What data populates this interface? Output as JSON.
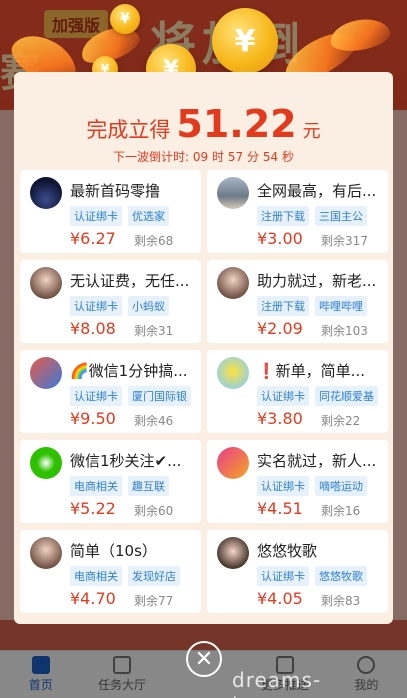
{
  "background": {
    "badge": "加强版",
    "big_text": "将加倒",
    "left_text": "赛"
  },
  "tabbar": [
    {
      "label": "首页",
      "icon": "home-icon",
      "active": true
    },
    {
      "label": "任务大厅",
      "icon": "list-icon",
      "active": false
    },
    {
      "label": "",
      "icon": "center-icon",
      "active": false
    },
    {
      "label": "更多推送",
      "icon": "grid-icon",
      "active": false
    },
    {
      "label": "我的",
      "icon": "user-icon",
      "active": false
    }
  ],
  "coin_symbol": "¥",
  "modal": {
    "hero_prefix": "完成立得",
    "hero_amount": "51.22",
    "hero_unit": "元",
    "countdown_label": "下一波倒计时:",
    "countdown_h": "09",
    "countdown_h_unit": "时",
    "countdown_m": "57",
    "countdown_m_unit": "分",
    "countdown_s": "54",
    "countdown_s_unit": "秒",
    "cards": [
      {
        "title": "最新首码零撸",
        "tags": [
          "认证绑卡",
          "优选家"
        ],
        "price": "¥6.27",
        "remain": "剩余68",
        "avatar": "night-city-icon"
      },
      {
        "title": "全网最高，有后...",
        "tags": [
          "注册下载",
          "三国主公"
        ],
        "price": "¥3.00",
        "remain": "剩余317",
        "avatar": "landscape-icon"
      },
      {
        "title": "无认证费，无任...",
        "tags": [
          "认证绑卡",
          "小蚂蚁"
        ],
        "price": "¥8.08",
        "remain": "剩余31",
        "avatar": "girl-photo-icon"
      },
      {
        "title": "助力就过，新老...",
        "tags": [
          "注册下载",
          "哔哩哔哩"
        ],
        "price": "¥2.09",
        "remain": "剩余103",
        "avatar": "girl-photo-icon"
      },
      {
        "title": "🌈微信1分钟搞...",
        "tags": [
          "认证绑卡",
          "厦门国际银"
        ],
        "price": "¥9.50",
        "remain": "剩余46",
        "avatar": "wallet-icon"
      },
      {
        "title": "❗新单，简单...",
        "tags": [
          "认证绑卡",
          "同花顺爱基"
        ],
        "price": "¥3.80",
        "remain": "剩余22",
        "avatar": "sponge-icon"
      },
      {
        "title": "微信1秒关注✔...",
        "tags": [
          "电商相关",
          "趣互联"
        ],
        "price": "¥5.22",
        "remain": "剩余60",
        "avatar": "wechat-icon"
      },
      {
        "title": "实名就过，新人...",
        "tags": [
          "认证绑卡",
          "嘀嗒运动"
        ],
        "price": "¥4.51",
        "remain": "剩余16",
        "avatar": "poster-icon"
      },
      {
        "title": "简单（10s）",
        "tags": [
          "电商相关",
          "发现好店"
        ],
        "price": "¥4.70",
        "remain": "剩余77",
        "avatar": "girl-photo-icon"
      },
      {
        "title": "悠悠牧歌",
        "tags": [
          "认证绑卡",
          "悠悠牧歌"
        ],
        "price": "¥4.05",
        "remain": "剩余83",
        "avatar": "boy-photo-icon"
      }
    ]
  },
  "close_symbol": "✕",
  "watermark": "dreams-true.com",
  "colors": {
    "accent": "#e23a1d",
    "tag_text": "#2d7fd2",
    "modal_bg": "#fbeee3",
    "coin": "#f7b81b"
  }
}
